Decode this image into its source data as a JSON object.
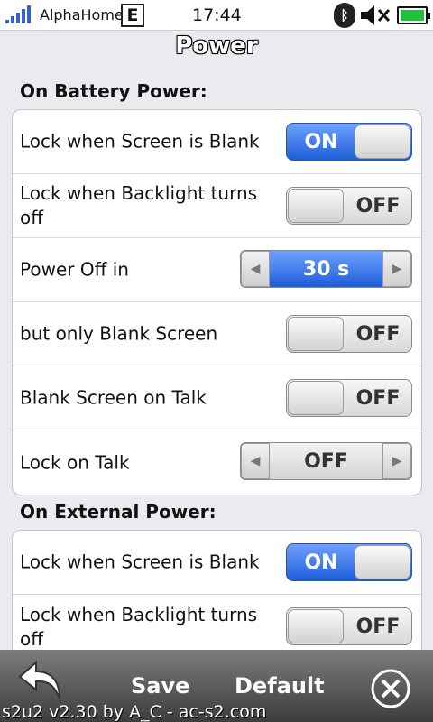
{
  "status_bar": {
    "carrier": "AlphaHome",
    "network_badge": "E",
    "time": "17:44",
    "icons": [
      "signal-icon",
      "bluetooth-icon",
      "volume-muted-icon",
      "battery-icon"
    ],
    "battery_color": "#1fc23b"
  },
  "title": "Power",
  "battery_section": {
    "header": "On Battery Power:",
    "rows": [
      {
        "label": "Lock when Screen is Blank",
        "control": "toggle",
        "value": "ON"
      },
      {
        "label": "Lock when Backlight turns off",
        "control": "toggle",
        "value": "OFF"
      },
      {
        "label": "Power Off in",
        "control": "spinner",
        "value": "30 s"
      },
      {
        "label": "but only Blank Screen",
        "control": "toggle",
        "value": "OFF"
      },
      {
        "label": "Blank Screen on Talk",
        "control": "toggle",
        "value": "OFF"
      },
      {
        "label": "Lock on Talk",
        "control": "spinner",
        "value": "OFF"
      }
    ]
  },
  "external_section": {
    "header": "On External Power:",
    "rows": [
      {
        "label": "Lock when Screen is Blank",
        "control": "toggle",
        "value": "ON"
      },
      {
        "label": "Lock when Backlight turns off",
        "control": "toggle",
        "value": "OFF"
      }
    ]
  },
  "bottom_bar": {
    "save_label": "Save",
    "default_label": "Default",
    "footer": "s2u2 v2.30 by A_C - ac-s2.com"
  },
  "colors": {
    "accent_blue": "#1d5fd8",
    "background": "#e9ebee"
  }
}
